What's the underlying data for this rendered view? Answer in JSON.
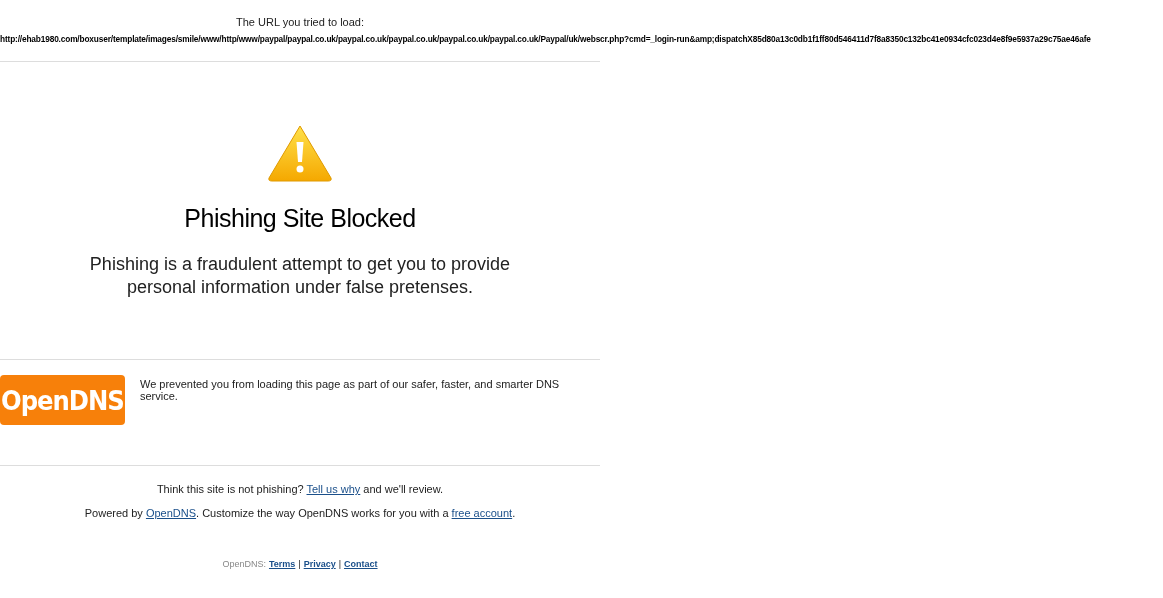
{
  "url_heading": "The URL you tried to load:",
  "url": "http://ehab1980.com/boxuser/template/images/smile/www/http/www/paypal/paypal.co.uk/paypal.co.uk/paypal.co.uk/paypal.co.uk/paypal.co.uk/Paypal/uk/webscr.php?cmd=_login-run&amp;dispatchX85d80a13c0db1f1ff80d546411d7f8a8350c132bc41e0934cfc023d4e8f9e5937a29c75ae46afe",
  "title": "Phishing Site Blocked",
  "description": "Phishing is a fraudulent attempt to get you to provide personal information under false pretenses.",
  "logo": "OpenDNS",
  "notice": "We prevented you from loading this page as part of our safer, faster, and smarter DNS service.",
  "review": {
    "before": "Think this site is not phishing?",
    "link": "Tell us why",
    "after": "and we'll review."
  },
  "powered": {
    "before": "Powered by",
    "link": "OpenDNS",
    "middle": ". Customize the way OpenDNS works for you with a",
    "link2": "free account",
    "after": "."
  },
  "footer": {
    "label": "OpenDNS:",
    "links": [
      "Terms",
      "Privacy",
      "Contact"
    ],
    "separator": "|"
  }
}
